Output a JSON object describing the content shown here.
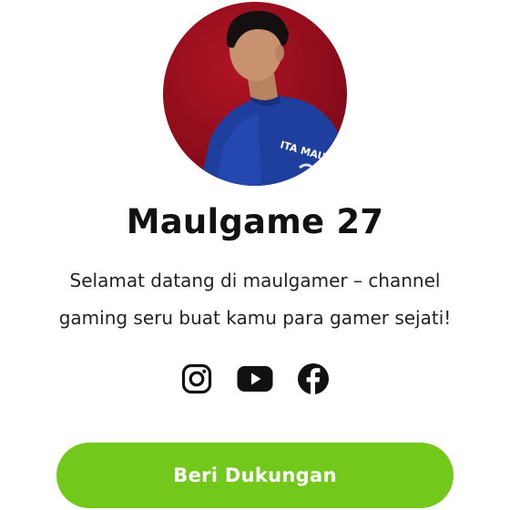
{
  "profile": {
    "name": "Maulgame 27",
    "bio_line1": "Selamat datang di maulgamer – channel",
    "bio_line2": "gaming seru buat kamu para gamer sejati!",
    "avatar_jersey_text": "ITA MAULANA"
  },
  "socials": [
    {
      "icon": "instagram-icon"
    },
    {
      "icon": "youtube-icon"
    },
    {
      "icon": "facebook-icon"
    }
  ],
  "cta": {
    "label": "Beri Dukungan"
  },
  "colors": {
    "accent": "#72c91b",
    "avatar_background": "#8f0d1c",
    "jersey": "#1f3f9e",
    "text": "#111111"
  }
}
